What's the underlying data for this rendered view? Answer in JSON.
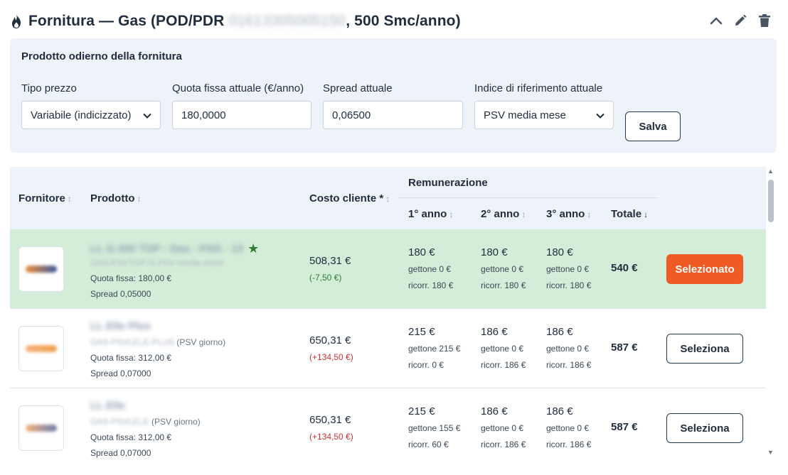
{
  "header": {
    "title_prefix": "Fornitura — Gas (POD/PDR ",
    "pdr_code": "01613305005150",
    "title_suffix": ", 500 Smc/anno)",
    "icons": [
      "flame-icon",
      "chevron-up-icon",
      "pencil-icon",
      "trash-icon"
    ]
  },
  "product": {
    "title": "Prodotto odierno della fornitura",
    "tipo_prezzo": {
      "label": "Tipo prezzo",
      "value": "Variabile (indicizzato)"
    },
    "quota_fissa": {
      "label": "Quota fissa attuale (€/anno)",
      "value": "180,0000"
    },
    "spread": {
      "label": "Spread attuale",
      "value": "0,06500"
    },
    "indice": {
      "label": "Indice di riferimento attuale",
      "value": "PSV media mese"
    },
    "save_label": "Salva"
  },
  "table": {
    "headers": {
      "fornitore": "Fornitore",
      "prodotto": "Prodotto",
      "costo": "Costo cliente *",
      "remunerazione": "Remunerazione",
      "anno1": "1° anno",
      "anno2": "2° anno",
      "anno3": "3° anno",
      "totale": "Totale"
    },
    "sort_icon": "↕",
    "sort_desc_icon": "↓",
    "rows": [
      {
        "product_name": "LL G-300 TOP - Gas - PSG - 13",
        "product_code": "GAS-PSVTOP-G-PSV media mese",
        "product_code_suffix": "",
        "quota": "Quota fissa: 180,00 €",
        "spread": "Spread 0,05000",
        "costo": "508,31 €",
        "delta": "(-7,50 €)",
        "y1": "180 €",
        "y1_g": "gettone 0 €",
        "y1_r": "ricorr. 180 €",
        "y2": "180 €",
        "y2_g": "gettone 0 €",
        "y2_r": "ricorr. 180 €",
        "y3": "180 €",
        "y3_g": "gettone 0 €",
        "y3_r": "ricorr. 180 €",
        "totale": "540 €",
        "button": "Selezionato",
        "selected": true
      },
      {
        "product_name": "LL Elle Plus",
        "product_code": "GAS-PSVLELE-PLUS",
        "product_code_suffix": " (PSV giorno)",
        "quota": "Quota fissa: 312,00 €",
        "spread": "Spread 0,07000",
        "costo": "650,31 €",
        "delta": "(+134,50 €)",
        "y1": "215 €",
        "y1_g": "gettone 215 €",
        "y1_r": "ricorr. 0 €",
        "y2": "186 €",
        "y2_g": "gettone 0 €",
        "y2_r": "ricorr. 186 €",
        "y3": "186 €",
        "y3_g": "gettone 0 €",
        "y3_r": "ricorr. 186 €",
        "totale": "587 €",
        "button": "Seleziona",
        "selected": false
      },
      {
        "product_name": "LL Elle",
        "product_code": "GAS-PSVLELE",
        "product_code_suffix": " (PSV giorno)",
        "quota": "Quota fissa: 312,00 €",
        "spread": "Spread 0,07000",
        "costo": "650,31 €",
        "delta": "(+134,50 €)",
        "y1": "215 €",
        "y1_g": "gettone 155 €",
        "y1_r": "ricorr. 60 €",
        "y2": "186 €",
        "y2_g": "gettone 0 €",
        "y2_r": "ricorr. 186 €",
        "y3": "186 €",
        "y3_g": "gettone 0 €",
        "y3_r": "ricorr. 186 €",
        "totale": "587 €",
        "button": "Seleziona",
        "selected": false
      }
    ]
  },
  "colors": {
    "selected_row": "#d4edd9",
    "accent_button": "#f05a24",
    "delta_negative": "#2e7d32",
    "delta_positive": "#d32f2f"
  }
}
